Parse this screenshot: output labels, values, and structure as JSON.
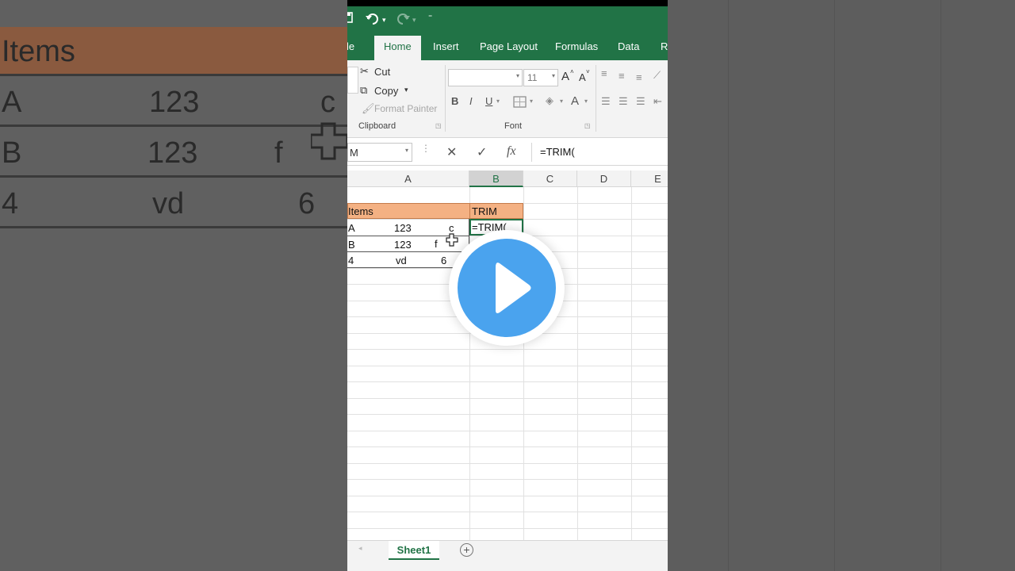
{
  "qat": {
    "save_icon": "save-icon",
    "undo_icon": "undo-icon",
    "redo_icon": "redo-icon",
    "more_icon": "customize-icon"
  },
  "tabs": [
    "le",
    "Home",
    "Insert",
    "Page Layout",
    "Formulas",
    "Data",
    "Re"
  ],
  "ribbon": {
    "cut": "Cut",
    "copy": "Copy",
    "format_painter": "Format Painter",
    "clipboard_label": "Clipboard",
    "font_label": "Font",
    "font_size": "11",
    "bold": "B",
    "italic": "I",
    "underline": "U",
    "font_color": "A",
    "grow_font": "A",
    "shrink_font": "A"
  },
  "formula_bar": {
    "name_box": "M",
    "cancel": "✕",
    "enter": "✓",
    "fx": "fx",
    "formula": "=TRIM("
  },
  "columns": [
    "A",
    "B",
    "C",
    "D",
    "E"
  ],
  "cells": {
    "header_items": "Items",
    "header_trim": "TRIM",
    "r1a": "A",
    "r1b": "123",
    "r1c": "c",
    "r1trim": "=TRIM(",
    "r2a": "B",
    "r2b": "123",
    "r2c": "f",
    "r3a": "4",
    "r3b": "vd",
    "r3c": "6"
  },
  "sheet": {
    "tab": "Sheet1",
    "add": "+"
  },
  "background": {
    "header": "Items",
    "rows": [
      [
        "A",
        "123",
        "c"
      ],
      [
        "B",
        "123",
        "f"
      ],
      [
        "4",
        "vd",
        "6"
      ]
    ]
  },
  "colors": {
    "excel_green": "#217346",
    "header_fill": "#f4b183",
    "play_blue": "#4aa3ee"
  }
}
